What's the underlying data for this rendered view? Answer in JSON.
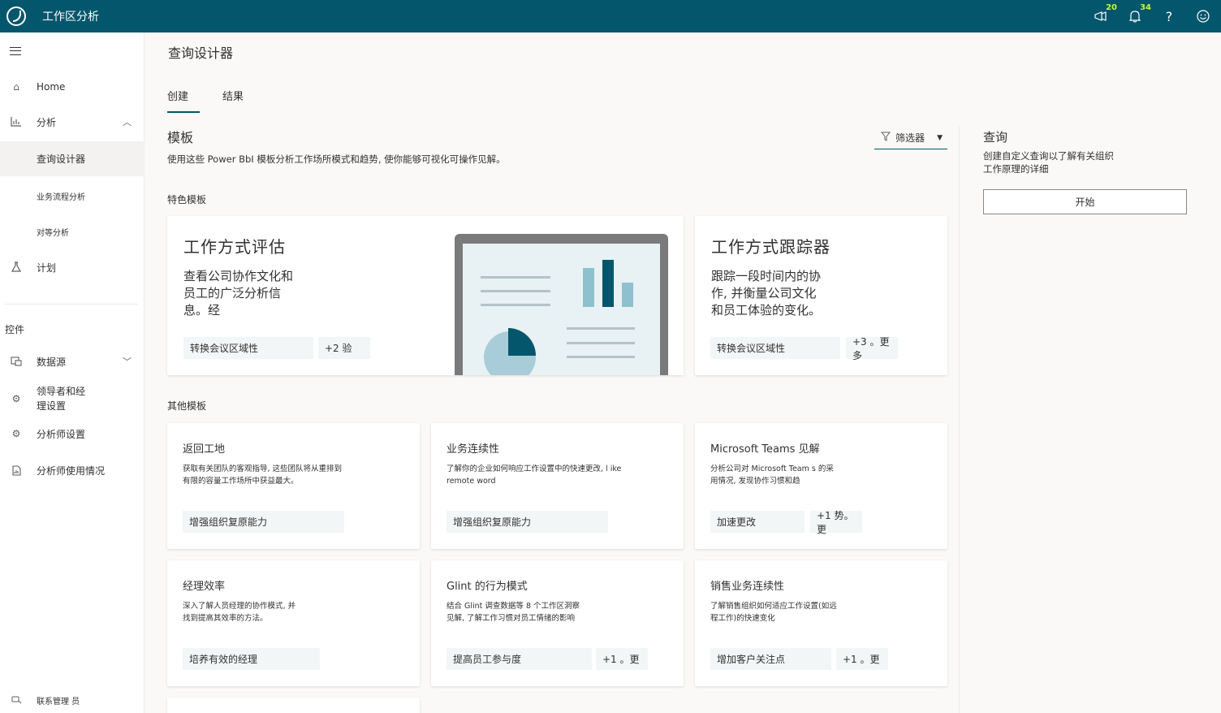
{
  "app": {
    "title": "工作区分析",
    "announcements_count": "20",
    "notifications_count": "34"
  },
  "sidebar": {
    "items": [
      {
        "label": "Home"
      },
      {
        "label": "分析"
      },
      {
        "label": "查询设计器"
      },
      {
        "label": "业务流程分析"
      },
      {
        "label": "对等分析"
      },
      {
        "label": "计划"
      }
    ],
    "section_label": "控件",
    "controls": [
      {
        "label": "数据源"
      },
      {
        "label": "领导者和经\n理设置"
      },
      {
        "label": "分析师设置"
      },
      {
        "label": "分析师使用情况"
      }
    ],
    "footer_label": "联系管理 员"
  },
  "page": {
    "title": "查询设计器",
    "tabs": [
      {
        "label": "创建"
      },
      {
        "label": "结果"
      }
    ]
  },
  "templates": {
    "heading": "模板",
    "description": "使用这些 Power BbI 模板分析工作场所模式和趋势, 使你能够可视化可操作见解。",
    "filter_label": "筛选器",
    "featured_label": "特色模板",
    "other_label": "其他模板",
    "featured": [
      {
        "title": "工作方式评估",
        "description": "查看公司协作文化和员工的广泛分析信息。经",
        "tag": "转换会议区域性",
        "more": "+2 验"
      },
      {
        "title": "工作方式跟踪器",
        "description": "跟踪一段时间内的协作, 并衡量公司文化和员工体验的变化。",
        "tag": "转换会议区域性",
        "more": "+3 。更多"
      }
    ],
    "other": [
      {
        "title": "返回工地",
        "description": "获取有关团队的客观指导, 这些团队将从重排到有限的容量工作场所中获益最大。",
        "tag": "增强组织复原能力",
        "more": ""
      },
      {
        "title": "业务连续性",
        "description": "了解你的企业如何响应工作设置中的快速更改, l ike remote word",
        "tag": "增强组织复原能力",
        "more": ""
      },
      {
        "title": "Microsoft Teams 见解",
        "description": "分析公司对 Microsoft Team s 的采用情况, 发现协作习惯和趋",
        "tag": "加速更改",
        "more": "+1 势。更"
      },
      {
        "title": "经理效率",
        "description": "深入了解人员经理的协作模式, 并找到提高其效率的方法。",
        "tag": "培养有效的经理",
        "more": ""
      },
      {
        "title": "Glint 的行为模式",
        "description": "结合 Glint 调查数据等 8 个工作区洞察见解, 了解工作习惯对员工情绪的影响",
        "tag": "提高员工参与度",
        "more": "+1 。更"
      },
      {
        "title": "销售业务连续性",
        "description": "了解销售组织如何适应工作设置(如远程工作)的快速变化",
        "tag": "增加客户关注点",
        "more": "+1 。更"
      }
    ]
  },
  "query_panel": {
    "title": "查询",
    "description": "创建自定义查询以了解有关组织工作原理的详细",
    "start_button": "开始"
  }
}
